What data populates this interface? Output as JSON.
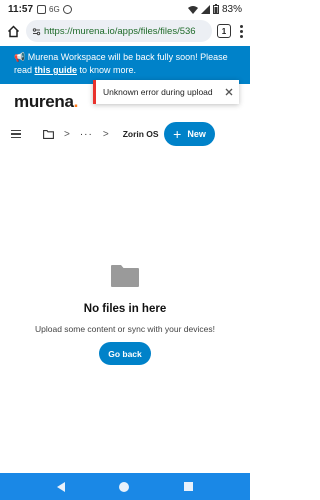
{
  "status_bar": {
    "time": "11:57",
    "battery": "83%",
    "icons": [
      "notification-icon",
      "network-icon",
      "shield-icon",
      "wifi-icon",
      "signal-icon",
      "battery-icon"
    ]
  },
  "browser": {
    "url": "https://murena.io/apps/files/files/536",
    "tab_count": "1"
  },
  "announcement": {
    "prefix": "📢 Murena Workspace will be back fully soon! Please read ",
    "link_text": "this guide",
    "suffix": " to know more."
  },
  "header": {
    "logo_main": "murena",
    "logo_dot_color": "#ff7a1a"
  },
  "toast": {
    "message": "Unknown error during upload",
    "accent_color": "#e9322d"
  },
  "toolbar": {
    "ellipsis": "···",
    "separator": ">",
    "current_folder": "Zorin OS",
    "new_label": "New"
  },
  "empty_state": {
    "title": "No files in here",
    "subtitle": "Upload some content or sync with your devices!",
    "button_label": "Go back"
  },
  "colors": {
    "accent": "#0082c9",
    "nav_bar": "#1a88e6"
  }
}
